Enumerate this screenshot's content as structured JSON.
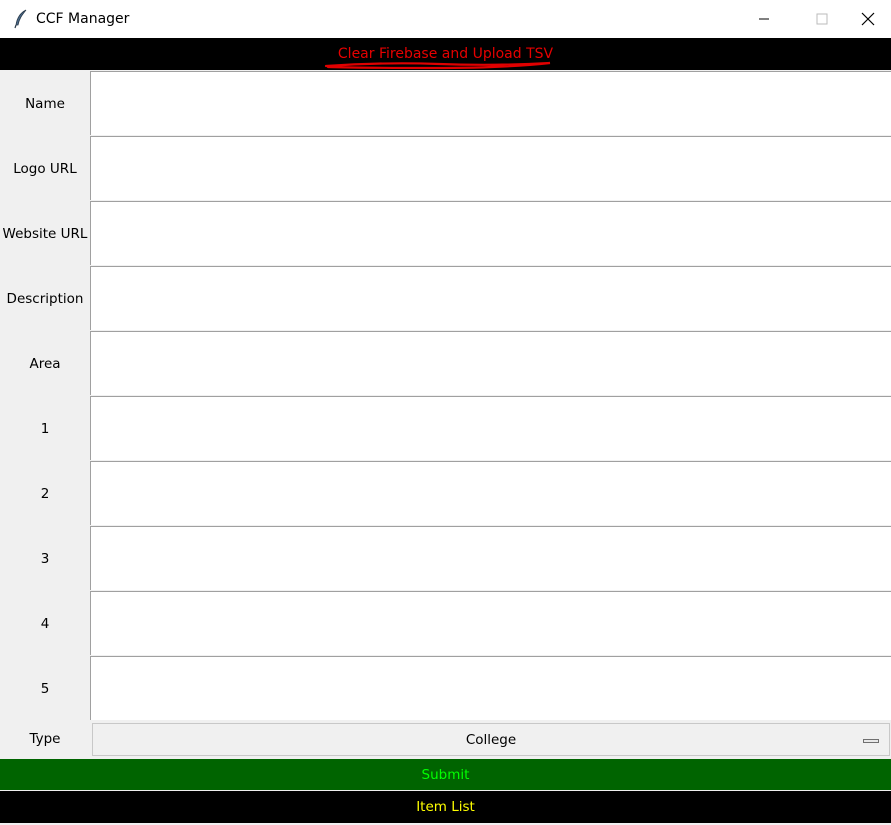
{
  "window": {
    "title": "CCF Manager",
    "icon": "feather-icon",
    "controls": [
      "minimize-icon",
      "maximize-icon",
      "close-icon"
    ]
  },
  "actions": {
    "clear_upload": "Clear Firebase and Upload TSV",
    "submit": "Submit",
    "item_list": "Item List"
  },
  "form": {
    "fields": [
      {
        "label": "Name",
        "value": ""
      },
      {
        "label": "Logo URL",
        "value": ""
      },
      {
        "label": "Website URL",
        "value": ""
      },
      {
        "label": "Description",
        "value": ""
      },
      {
        "label": "Area",
        "value": ""
      },
      {
        "label": "1",
        "value": ""
      },
      {
        "label": "2",
        "value": ""
      },
      {
        "label": "3",
        "value": ""
      },
      {
        "label": "4",
        "value": ""
      },
      {
        "label": "5",
        "value": ""
      }
    ],
    "type": {
      "label": "Type",
      "selected": "College"
    }
  },
  "colors": {
    "clear_text": "#e60000",
    "clear_bg": "#000000",
    "submit_bg": "#006400",
    "submit_text": "#00ff00",
    "item_list_bg": "#000000",
    "item_list_text": "#ffff00",
    "annotation_underline": "#e00000"
  }
}
